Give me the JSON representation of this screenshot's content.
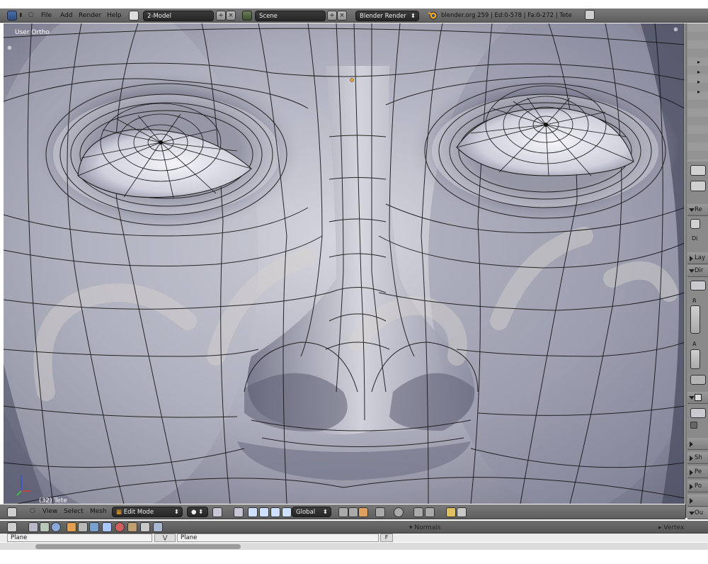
{
  "menus": [
    "File",
    "Add",
    "Render",
    "Help"
  ],
  "screen_layout": "2-Model",
  "scene": "Scene",
  "render_engine": "Blender Render",
  "status": "blender.org 259 | Ed:0-578 | Fa:0-272 | Tete",
  "viewport": {
    "view_label": "User Ortho",
    "object_label": "(32) Tete"
  },
  "right_panel": {
    "items": [
      "Re",
      "Di",
      "Lay",
      "Dir",
      "R",
      "A",
      "Sh",
      "Pe",
      "Po",
      "Ou"
    ]
  },
  "viewport_header": {
    "menus": [
      "View",
      "Select",
      "Mesh"
    ],
    "mode": "Edit Mode",
    "orientation": "Global"
  },
  "bottom_panel": {
    "left_field": "Plane",
    "right_field": "Plane",
    "normals_label": "Normals",
    "vertex_label": "Vertex"
  },
  "colors": {
    "header": "#6b6b6b",
    "viewport_bg": "#7c7d8e",
    "mesh_wire": "#141414",
    "skin_light": "#c9ccd6",
    "skin_dark": "#5d5f74",
    "accent": "#f5a623"
  }
}
